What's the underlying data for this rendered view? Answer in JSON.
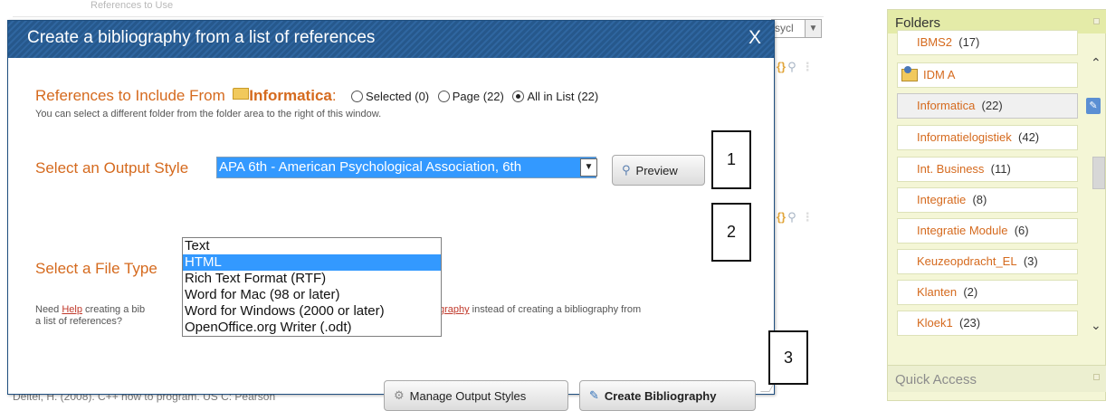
{
  "background": {
    "top_text": "References to Use",
    "select_value": "sycl",
    "bottom_text": "Deitel, H. (2008). C++ how to program. US C: Pearson"
  },
  "dialog": {
    "title": "Create a bibliography from a list of references",
    "close_label": "X",
    "references": {
      "label": "References to Include From",
      "folder_name": "Informatica",
      "colon": ":",
      "options": [
        {
          "label": "Selected (0)",
          "checked": false
        },
        {
          "label": "Page (22)",
          "checked": false
        },
        {
          "label": "All in List (22)",
          "checked": true
        }
      ],
      "note": "You can select a different folder from the folder area to the right of this window."
    },
    "output_style": {
      "label": "Select an Output Style",
      "selected": "APA 6th - American Psychological Association, 6th",
      "preview_label": "Preview"
    },
    "file_type": {
      "label": "Select a File Type",
      "options": [
        "Text",
        "HTML",
        "Rich Text Format (RTF)",
        "Word for Mac (98 or later)",
        "Word for Windows (2000 or later)",
        "OpenOffice.org Writer (.odt)"
      ],
      "selected_index": 1
    },
    "help": {
      "pre": "Need ",
      "link1": "Help",
      "mid": " creating a bib",
      "link2": "d bibliography",
      "post": " instead of creating a bibliography from",
      "line2": "a list of references?"
    },
    "manage_label": "Manage Output Styles",
    "create_label": "Create Bibliography"
  },
  "annotations": [
    "1",
    "2",
    "3"
  ],
  "folders": {
    "title": "Folders",
    "items": [
      {
        "name": "IBMS2",
        "count": "(17)"
      },
      {
        "name": "IDM A",
        "count": "",
        "type": "group"
      },
      {
        "name": "Informatica",
        "count": "(22)",
        "active": true
      },
      {
        "name": "Informatielogistiek",
        "count": "(42)"
      },
      {
        "name": "Int. Business",
        "count": "(11)"
      },
      {
        "name": "Integratie",
        "count": "(8)"
      },
      {
        "name": "Integratie Module",
        "count": "(6)"
      },
      {
        "name": "Keuzeopdracht_EL",
        "count": "(3)"
      },
      {
        "name": "Klanten",
        "count": "(2)"
      },
      {
        "name": "Kloek1",
        "count": "(23)"
      }
    ],
    "quick_access": "Quick Access"
  },
  "colors": {
    "accent_orange": "#d56a1e",
    "title_blue": "#26588c",
    "selection": "#3399ff"
  },
  "icons": [
    "close-icon",
    "folder-icon",
    "magnifier-icon",
    "gear-icon",
    "pencil-icon",
    "group-folder-icon",
    "chevron-up-icon",
    "chevron-down-icon"
  ]
}
